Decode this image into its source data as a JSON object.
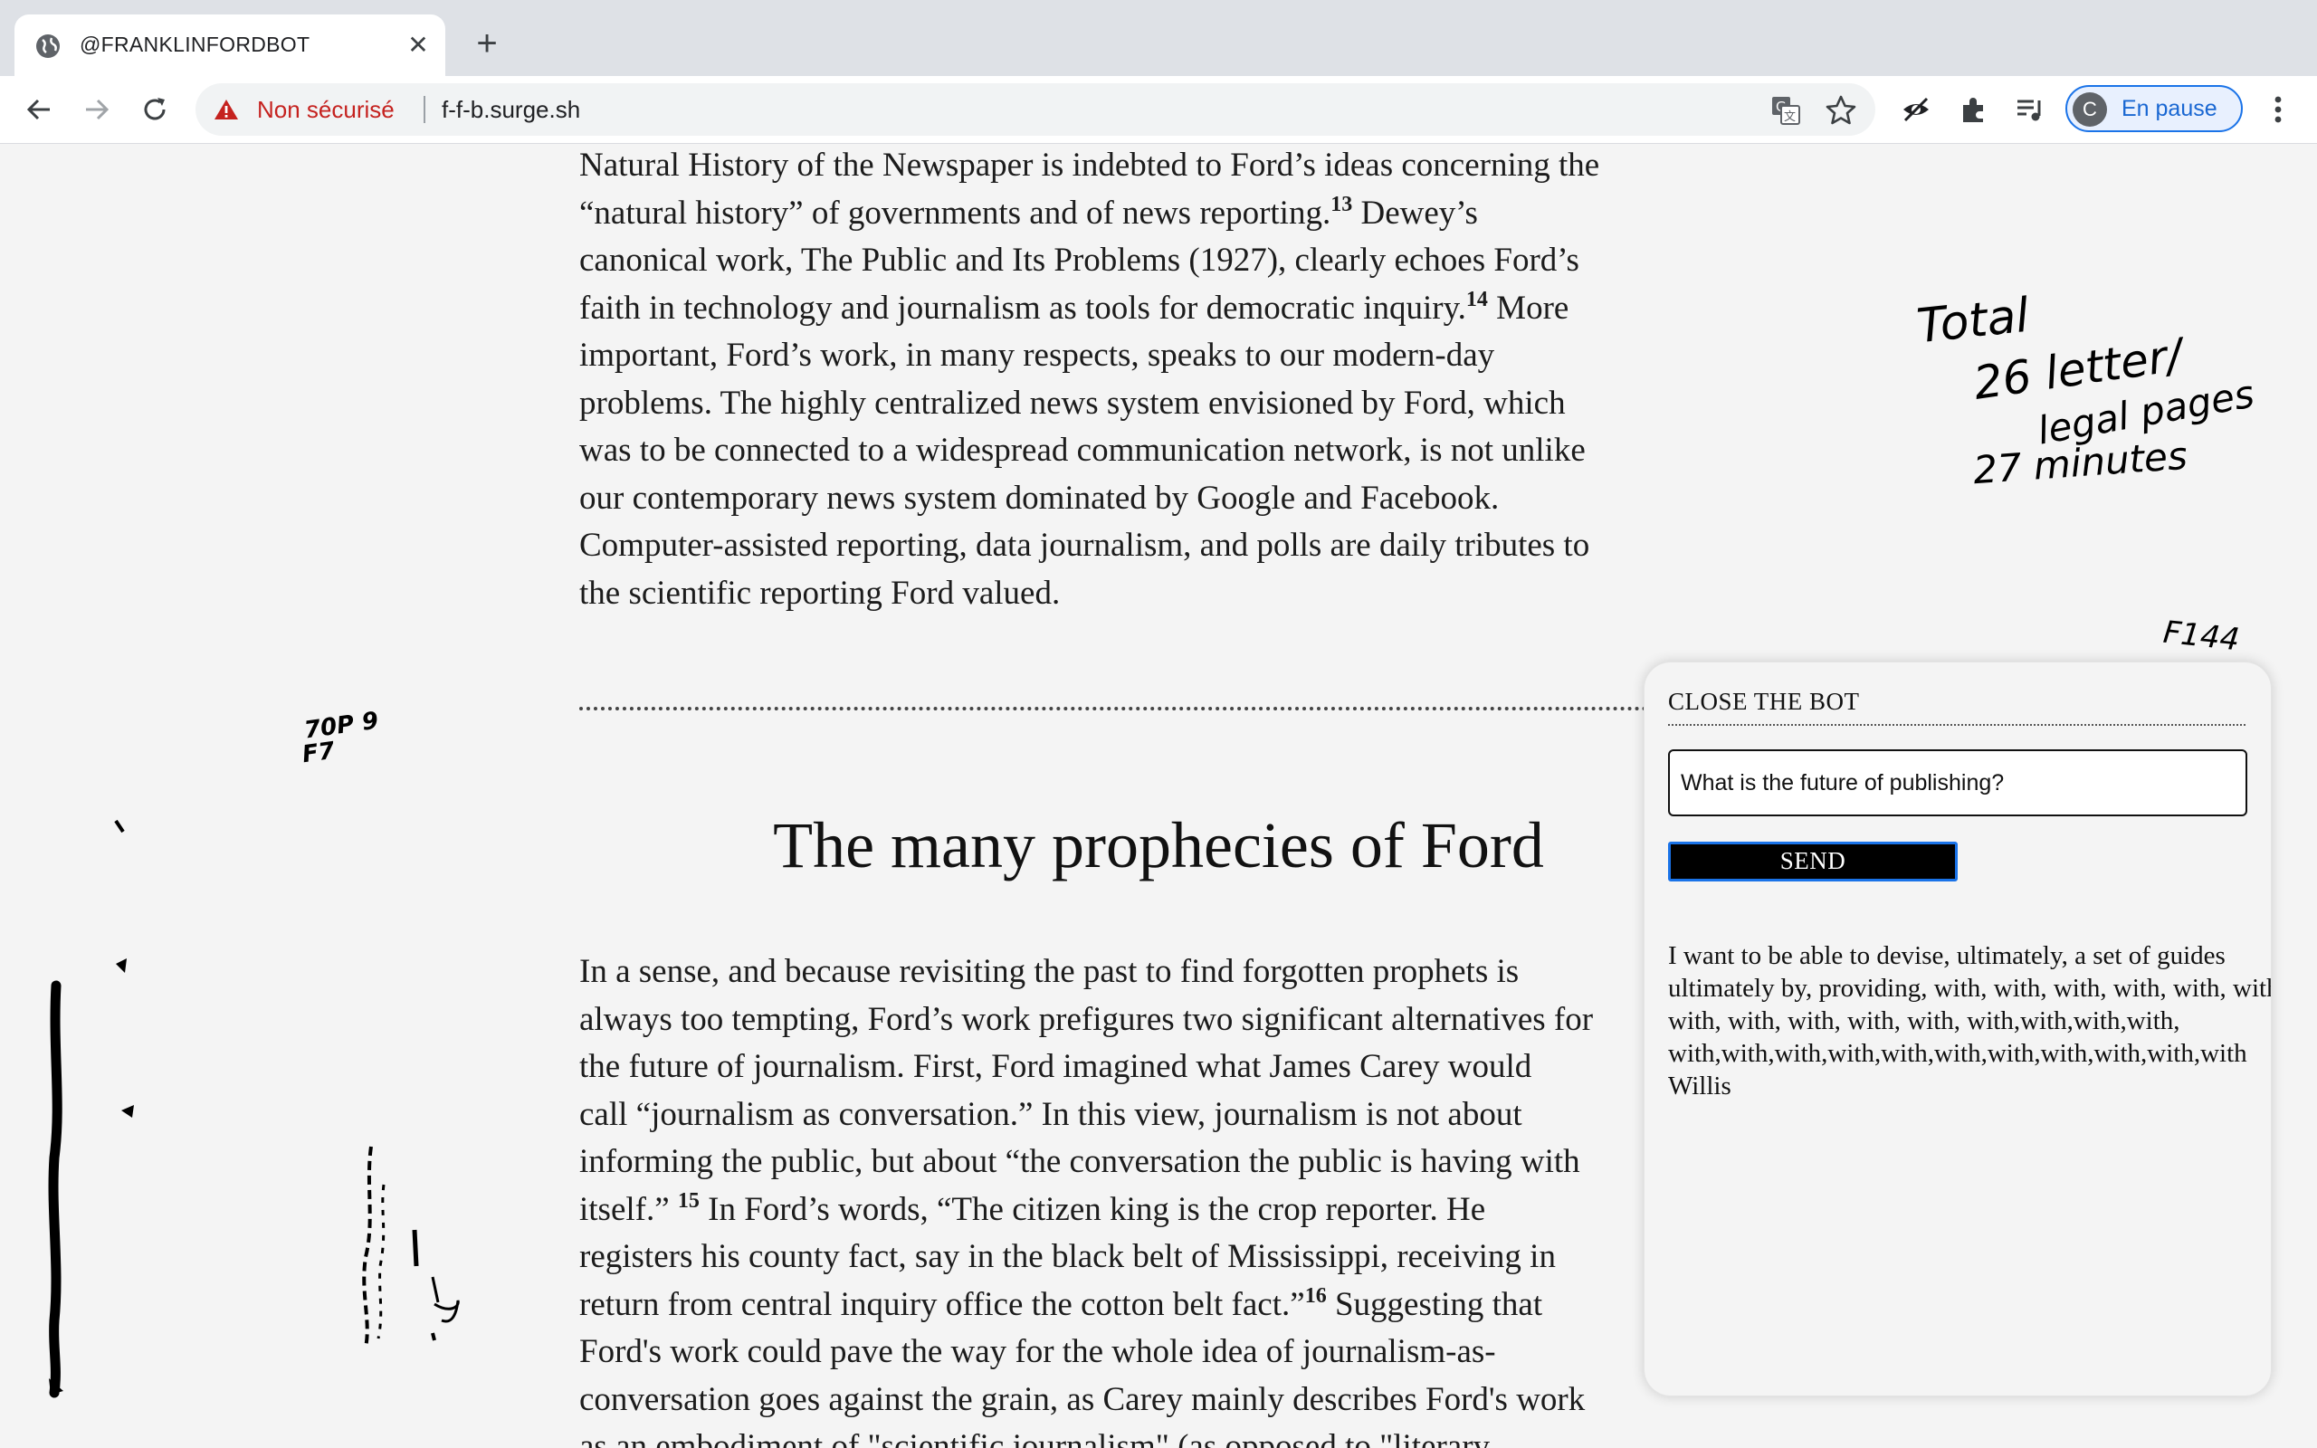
{
  "browser": {
    "tab_title": "@FRANKLINFORDBOT",
    "not_secure_label": "Non sécurisé",
    "url": "f-f-b.surge.sh",
    "profile_initial": "C",
    "profile_label": "En pause"
  },
  "article": {
    "paragraph_top": {
      "pre13": "Natural History of the Newspaper is indebted to Ford’s ideas concerning the\n“natural history” of governments and of news reporting.",
      "fn13": "13",
      "pre14": " Dewey’s\ncanonical work, The Public and Its Problems (1927), clearly echoes Ford’s\nfaith in technology and journalism as tools for democratic inquiry.",
      "fn14": "14",
      "post14": " More\nimportant, Ford’s work, in many respects, speaks to our modern-day\nproblems. The highly centralized news system envisioned by Ford, which\nwas to be connected to a widespread communication network, is not unlike\nour contemporary news system dominated by Google and Facebook.\nComputer-assisted reporting, data journalism, and polls are daily tributes to\nthe scientific reporting Ford valued."
    },
    "section_heading": "The many prophecies of Ford",
    "paragraph_bottom": {
      "pre15": "In a sense, and because revisiting the past to find forgotten prophets is\nalways too tempting, Ford’s work prefigures two significant alternatives for\nthe future of journalism. First, Ford imagined what James Carey would\ncall “journalism as conversation.” In this view, journalism is not about\ninforming the public, but about “the conversation the public is having with\nitself.” ",
      "fn15": "15",
      "pre16": " In Ford’s words, “The citizen king is the crop reporter. He\nregisters his county fact, say in the black belt of Mississippi, receiving in\nreturn from central inquiry office the cotton belt fact.”",
      "fn16": "16",
      "post16": " Suggesting that\nFord's work could pave the way for the whole idea of journalism-as-\nconversation goes against the grain, as Carey mainly describes Ford's work\nas an embodiment of \"scientific journalism\" (as opposed to \"literary"
    }
  },
  "handwriting": {
    "total": "Total",
    "letters": "26 letter/",
    "pages": "legal pages",
    "minutes": "27 minutes",
    "f144": "F144",
    "margin_a": "70P 9",
    "margin_b": "F7"
  },
  "bot": {
    "close_label": "CLOSE THE BOT",
    "input_value": "What is the future of publishing?",
    "send_label": "SEND",
    "response": "I want to be able to devise, ultimately, a set of guides\nultimately by, providing, with, with, with, with, with, with\nwith, with, with, with, with, with,with,with,with,\nwith,with,with,with,with,with,with,with,with,with,with\nWillis"
  }
}
